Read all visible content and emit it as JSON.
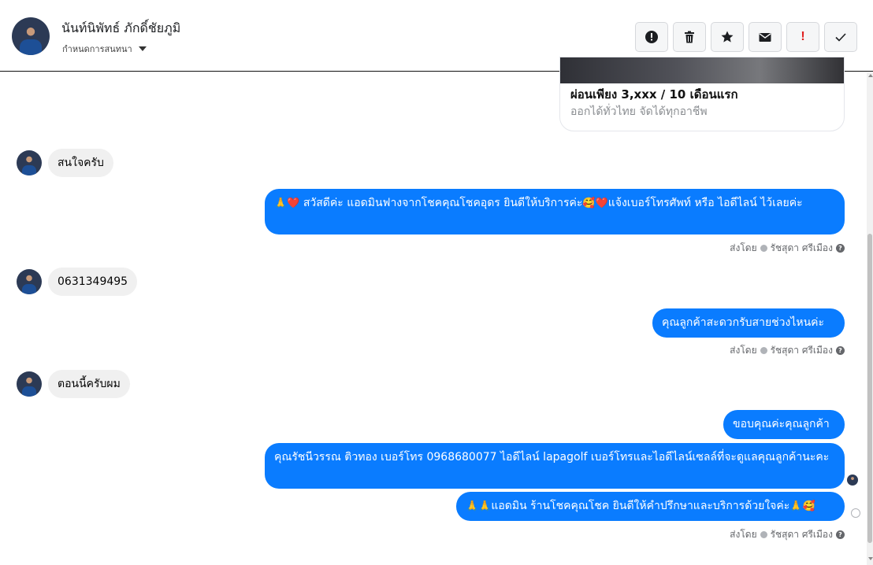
{
  "header": {
    "contact_name": "นันท์นิพัทธ์ ภักดิ์ชัยภูมิ",
    "conversation_menu": "กำหนดการสนทนา"
  },
  "actions": [
    {
      "name": "spam",
      "icon": "alert-circle-icon"
    },
    {
      "name": "delete",
      "icon": "trash-icon"
    },
    {
      "name": "star",
      "icon": "star-icon"
    },
    {
      "name": "mark-unread",
      "icon": "envelope-icon"
    },
    {
      "name": "follow-up",
      "icon": "exclamation-icon",
      "label": "!"
    },
    {
      "name": "done",
      "icon": "check-icon"
    }
  ],
  "ad_card": {
    "title": "ผ่อนเพียง 3,xxx / 10 เดือนแรก",
    "subtitle": "ออกได้ทั่วไทย จัดได้ทุกอาชีพ"
  },
  "messages": [
    {
      "from": "customer",
      "text": "สนใจครับ"
    },
    {
      "from": "page",
      "prefix_emoji": "🙏❤️",
      "text": " สวัสดีค่ะ แอดมินฟางจากโชคคุณโชคอุดร ยินดีให้บริการค่ะ",
      "mid_emoji": "🥰❤️",
      "text2": "แจ้งเบอร์โทรศัพท์ หรือ ไอดีไลน์  ไว้เลยค่ะ"
    },
    {
      "from": "customer",
      "text": "0631349495"
    },
    {
      "from": "page",
      "text": "คุณลูกค้าสะดวกรับสายช่วงไหนค่ะ"
    },
    {
      "from": "customer",
      "text": "ตอนนี้ครับผม"
    },
    {
      "from": "page",
      "text": "ขอบคุณค่ะคุณลูกค้า"
    },
    {
      "from": "page",
      "text": "คุณรัชนีวรรณ ติวทอง      เบอร์โทร 0968680077  ไอดีไลน์ lapagolf  เบอร์โทรและไอดีไลน์เซลล์ที่จะดูแลคุณลูกค้านะคะ"
    },
    {
      "from": "page",
      "prefix_emoji": "🙏🙏",
      "text": "แอดมิน ร้านโชคคุณโชค ยินดีให้คำปรึกษาและบริการด้วยใจค่ะ",
      "suffix_emoji": "🙏🥰"
    }
  ],
  "sent_by": {
    "label": "ส่งโดย",
    "agent": "รัชสุดา ศรีเมือง",
    "help": "?"
  }
}
